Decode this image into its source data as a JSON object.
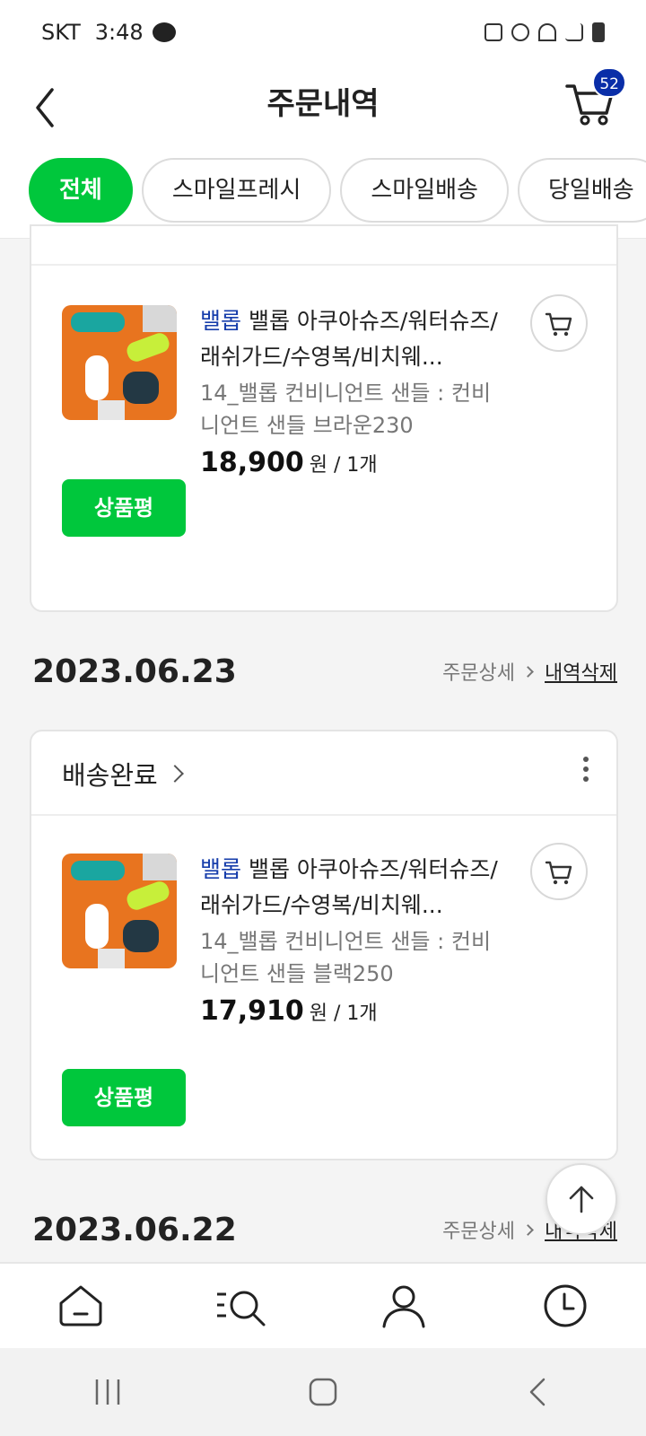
{
  "status_bar": {
    "carrier": "SKT",
    "time": "3:48"
  },
  "header": {
    "title": "주문내역",
    "cart_count": "52"
  },
  "filters": [
    "전체",
    "스마일프레시",
    "스마일배송",
    "당일배송"
  ],
  "orders": [
    {
      "item": {
        "brand": "밸롭",
        "name": "밸롭 아쿠아슈즈/워터슈즈/래쉬가드/수영복/비치웨...",
        "option": "14_밸롭 컨비니언트 샌들 : 컨비니언트 샌들 브라운230",
        "price": "18,900",
        "unit": "원 / 1개",
        "review_label": "상품평"
      }
    },
    {
      "date": "2023.06.23",
      "detail_label": "주문상세",
      "delete_label": "내역삭제",
      "status": "배송완료",
      "item": {
        "brand": "밸롭",
        "name": "밸롭 아쿠아슈즈/워터슈즈/래쉬가드/수영복/비치웨...",
        "option": "14_밸롭 컨비니언트 샌들 : 컨비니언트 샌들 블랙250",
        "price": "17,910",
        "unit": "원 / 1개",
        "review_label": "상품평"
      }
    },
    {
      "date": "2023.06.22",
      "detail_label": "주문상세",
      "delete_label": "내역삭제"
    }
  ],
  "icons": {
    "back": "chevron-left-icon",
    "cart": "cart-icon",
    "more": "more-vertical-icon",
    "scroll_top": "arrow-up-icon",
    "nav": [
      "home-icon",
      "search-list-icon",
      "user-icon",
      "clock-icon"
    ]
  },
  "colors": {
    "accent": "#00c73c",
    "brand": "#163dab",
    "badge": "#0a2ea8"
  }
}
